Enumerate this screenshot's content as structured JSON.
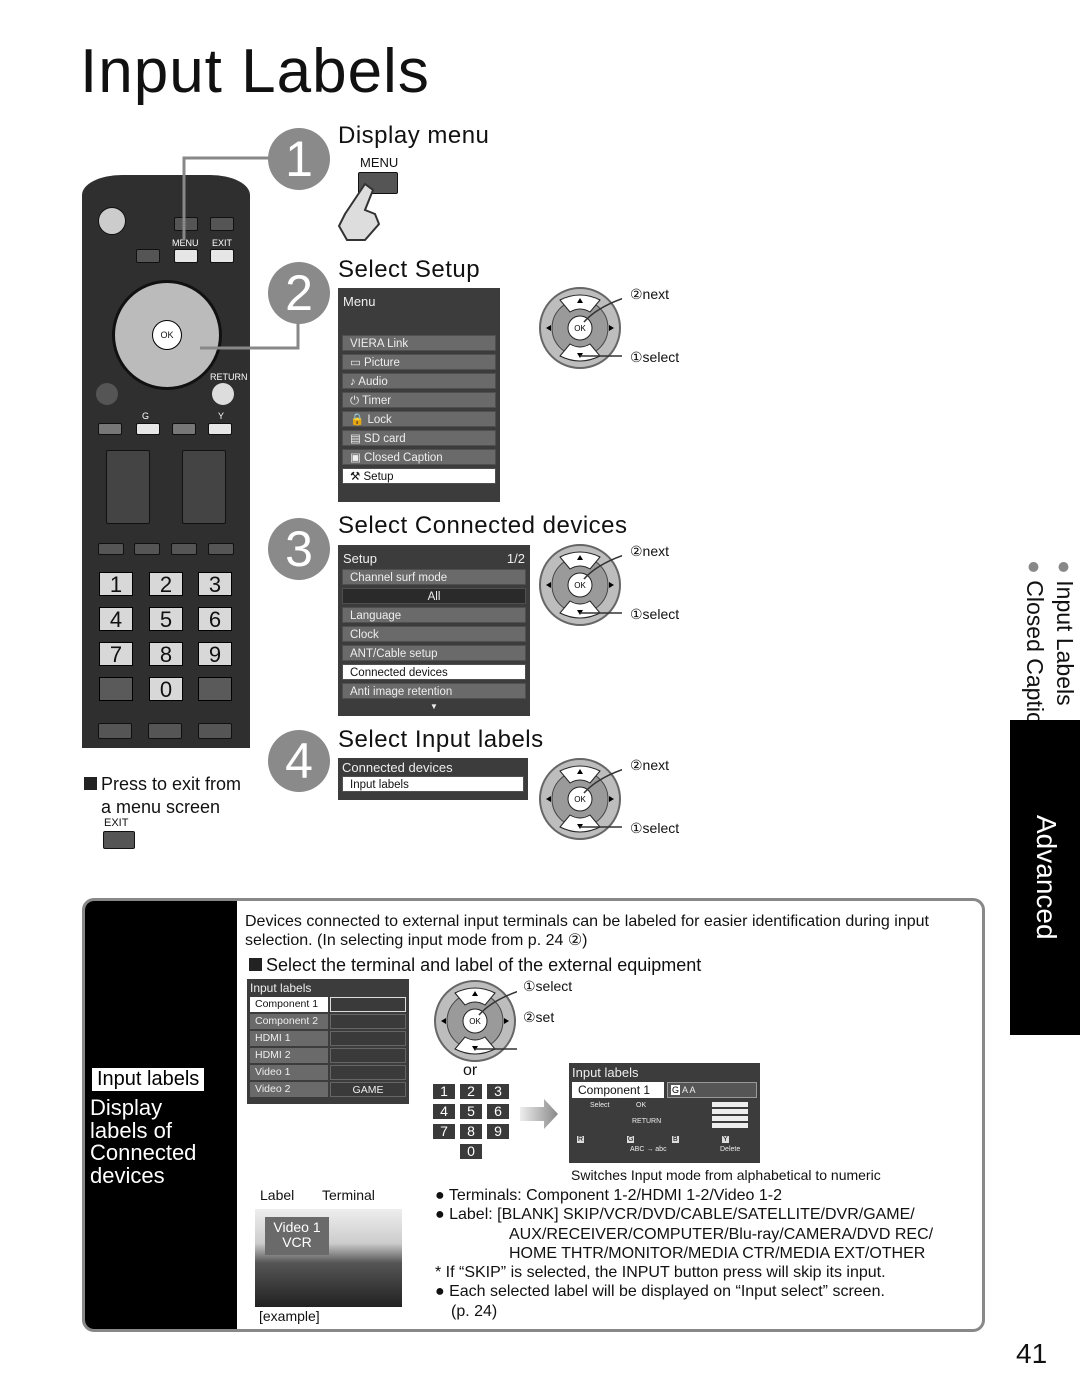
{
  "title": "Input Labels",
  "page_number": "41",
  "side_tab": {
    "line1": "Input Labels",
    "line2": "Closed Caption",
    "section": "Advanced"
  },
  "remote": {
    "menu": "MENU",
    "exit": "EXIT",
    "return": "RETURN",
    "ok": "OK",
    "g": "G",
    "y": "Y",
    "keys": [
      "1",
      "2",
      "3",
      "4",
      "5",
      "6",
      "7",
      "8",
      "9",
      "0"
    ]
  },
  "exit_note": {
    "text1": "Press to exit from",
    "text2": "a menu screen",
    "button": "EXIT"
  },
  "step1": {
    "num": "1",
    "heading": "Display menu",
    "button": "MENU"
  },
  "step2": {
    "num": "2",
    "heading": "Select   Setup",
    "menu_title": "Menu",
    "items": [
      "VIERA Link",
      "▭ Picture",
      "♪ Audio",
      "⏻ Timer",
      "🔒 Lock",
      "▤ SD card",
      "▣ Closed Caption",
      "⚒ Setup"
    ],
    "selected": 7
  },
  "step3": {
    "num": "3",
    "heading": "Select   Connected devices",
    "menu_title": "Setup",
    "page": "1/2",
    "items": [
      "Channel surf mode",
      "All",
      "Language",
      "Clock",
      "ANT/Cable setup",
      "Connected devices",
      "Anti image retention"
    ],
    "selected": 5
  },
  "step4": {
    "num": "4",
    "heading": "Select   Input labels",
    "menu_title": "Connected devices",
    "items": [
      "Input labels"
    ]
  },
  "nav": {
    "next": "②next",
    "select": "①select",
    "set": "②set",
    "ok": "OK"
  },
  "section": {
    "side_label": "Input labels",
    "side_desc": [
      "Display",
      "labels of",
      "Connected",
      "devices"
    ],
    "intro": "Devices connected to external input terminals can be labeled for easier identification during input selection. (In selecting input mode from p. 24 ②)",
    "subheading": "Select the terminal and label of the external equipment",
    "osd_title": "Input labels",
    "terminals": [
      {
        "name": "Component 1",
        "label": ""
      },
      {
        "name": "Component 2",
        "label": ""
      },
      {
        "name": "HDMI 1",
        "label": ""
      },
      {
        "name": "HDMI 2",
        "label": ""
      },
      {
        "name": "Video 1",
        "label": ""
      },
      {
        "name": "Video 2",
        "label": "GAME"
      }
    ],
    "or": "or",
    "keyboard": {
      "title": "Input labels",
      "terminal": "Component 1",
      "value": "A A",
      "cursor": "G",
      "select": "Select",
      "ok": "OK",
      "return": "RETURN",
      "r": "R",
      "g": "G",
      "b": "B",
      "y": "Y",
      "abc": "ABC → abc",
      "delete": "Delete"
    },
    "switch_note": "Switches Input mode from alphabetical to numeric",
    "example": {
      "label": "Label",
      "terminal": "Terminal",
      "osd_line1": "Video 1",
      "osd_line2": "VCR",
      "caption": "[example]"
    },
    "bullets": [
      "● Terminals:  Component 1-2/HDMI 1-2/Video 1-2",
      "● Label:  [BLANK] SKIP/VCR/DVD/CABLE/SATELLITE/DVR/GAME/",
      "AUX/RECEIVER/COMPUTER/Blu-ray/CAMERA/DVD REC/",
      "HOME THTR/MONITOR/MEDIA CTR/MEDIA EXT/OTHER",
      "*  If “SKIP” is selected, the INPUT button press will skip its input.",
      "● Each selected label will be displayed on “Input select” screen.",
      "(p. 24)"
    ]
  }
}
